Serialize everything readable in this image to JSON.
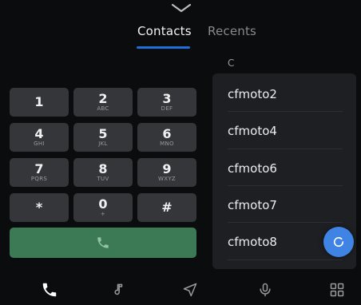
{
  "tabs": {
    "contacts": "Contacts",
    "recents": "Recents",
    "active": "contacts"
  },
  "contacts": {
    "section_letter": "C",
    "items": [
      "cfmoto2",
      "cfmoto4",
      "cfmoto6",
      "cfmoto7",
      "cfmoto8"
    ]
  },
  "keypad": {
    "keys": [
      {
        "digit": "1",
        "letters": ""
      },
      {
        "digit": "2",
        "letters": "ABC"
      },
      {
        "digit": "3",
        "letters": "DEF"
      },
      {
        "digit": "4",
        "letters": "GHI"
      },
      {
        "digit": "5",
        "letters": "JKL"
      },
      {
        "digit": "6",
        "letters": "MNO"
      },
      {
        "digit": "7",
        "letters": "PQRS"
      },
      {
        "digit": "8",
        "letters": "TUV"
      },
      {
        "digit": "9",
        "letters": "WXYZ"
      },
      {
        "digit": "*",
        "letters": ""
      },
      {
        "digit": "0",
        "letters": "+"
      },
      {
        "digit": "#",
        "letters": ""
      }
    ]
  },
  "icons": {
    "pull_handle": "chevron-down-icon",
    "call": "phone-icon",
    "fab": "refresh-icon",
    "nav": [
      "phone-icon",
      "music-icon",
      "navigation-icon",
      "microphone-icon",
      "apps-grid-icon"
    ]
  },
  "colors": {
    "accent": "#1e6fd6",
    "call_button": "#3c7a56",
    "fab": "#3f84e5",
    "key_bg": "#34363a",
    "panel_bg": "#1d1f22"
  }
}
